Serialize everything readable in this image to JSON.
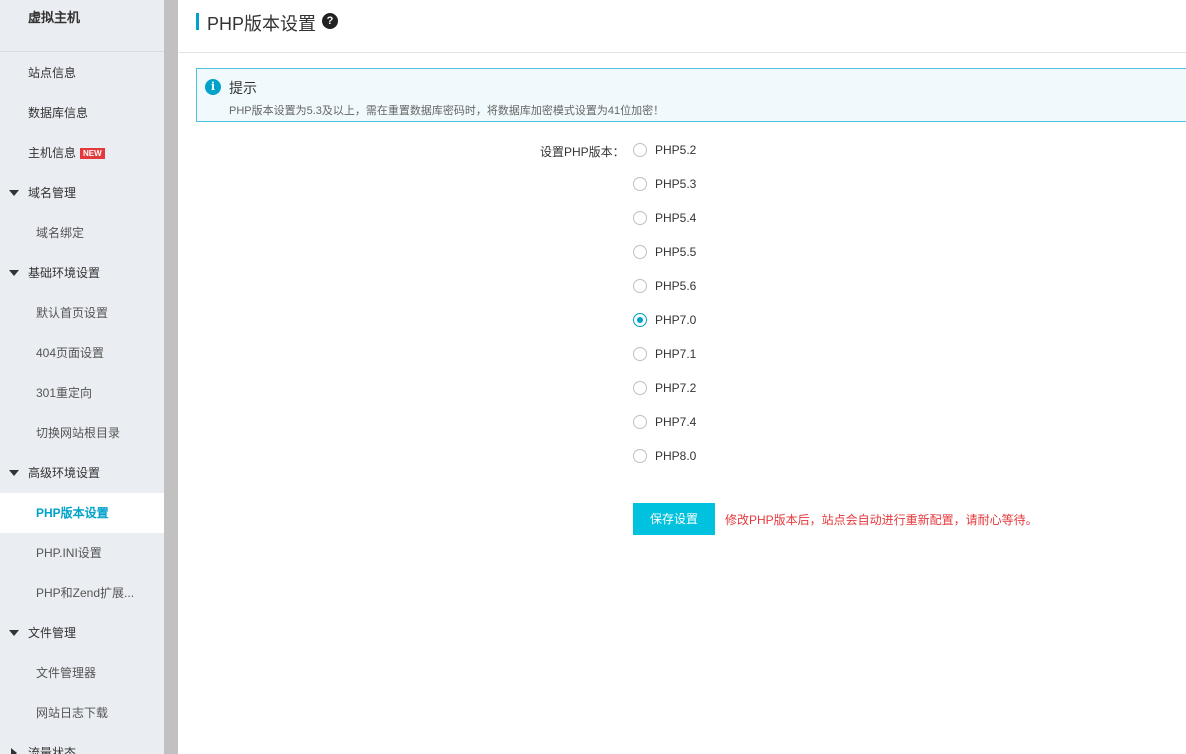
{
  "sidebar": {
    "title": "虚拟主机",
    "items": [
      {
        "label": "站点信息",
        "kind": "item"
      },
      {
        "label": "数据库信息",
        "kind": "item"
      },
      {
        "label": "主机信息",
        "kind": "item",
        "badge": "NEW"
      },
      {
        "label": "域名管理",
        "kind": "group"
      },
      {
        "label": "域名绑定",
        "kind": "sub"
      },
      {
        "label": "基础环境设置",
        "kind": "group"
      },
      {
        "label": "默认首页设置",
        "kind": "sub"
      },
      {
        "label": "404页面设置",
        "kind": "sub"
      },
      {
        "label": "301重定向",
        "kind": "sub"
      },
      {
        "label": "切换网站根目录",
        "kind": "sub"
      },
      {
        "label": "高级环境设置",
        "kind": "group"
      },
      {
        "label": "PHP版本设置",
        "kind": "sub",
        "active": true
      },
      {
        "label": "PHP.INI设置",
        "kind": "sub"
      },
      {
        "label": "PHP和Zend扩展...",
        "kind": "sub"
      },
      {
        "label": "文件管理",
        "kind": "group"
      },
      {
        "label": "文件管理器",
        "kind": "sub"
      },
      {
        "label": "网站日志下载",
        "kind": "sub"
      },
      {
        "label": "流量状态",
        "kind": "group-collapsed"
      }
    ]
  },
  "header": {
    "title": "PHP版本设置",
    "help_icon": "?"
  },
  "tip": {
    "icon": "i",
    "title": "提示",
    "text": "PHP版本设置为5.3及以上，需在重置数据库密码时，将数据库加密模式设置为41位加密！"
  },
  "form": {
    "label": "设置PHP版本：",
    "options": [
      "PHP5.2",
      "PHP5.3",
      "PHP5.4",
      "PHP5.5",
      "PHP5.6",
      "PHP7.0",
      "PHP7.1",
      "PHP7.2",
      "PHP7.4",
      "PHP8.0"
    ],
    "selected": "PHP7.0",
    "save_label": "保存设置",
    "save_note": "修改PHP版本后，站点会自动进行重新配置，请耐心等待。"
  },
  "colors": {
    "accent": "#00a2ca",
    "button": "#00c1de",
    "badge": "#e4393c",
    "warning": "#e4393c"
  }
}
